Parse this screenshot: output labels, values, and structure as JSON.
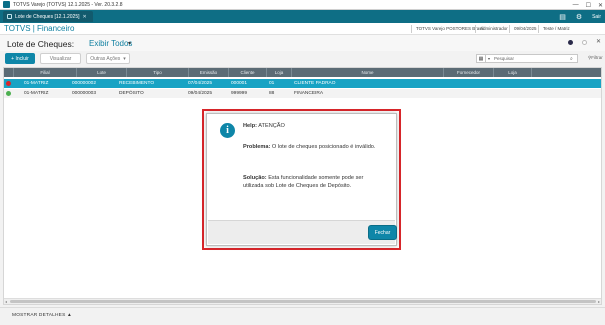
{
  "window": {
    "title": "TOTVS Varejo (TOTVS) 12.1.2025 - Ver. 20.3.2.8",
    "controls": [
      "—",
      "☐",
      "✕"
    ]
  },
  "tabbar": {
    "tab_label": "Lote de Cheques [12.1.2025]",
    "tab_close": "✕",
    "sair_label": "Sair"
  },
  "module": {
    "title": "TOTVS | Financeiro",
    "info": [
      "TOTVS Varejo POSTORES Brasil",
      "Administrador",
      "09/04/2025",
      "Teste / Matriz"
    ]
  },
  "page": {
    "title": "Lote de Cheques:",
    "view_label": "Exibir Todos",
    "view_caret": "▾"
  },
  "toolbar": {
    "include_label": "+ Incluir",
    "view_label": "Visualizar",
    "other_actions_label": "Outras Ações",
    "other_actions_caret": "▾",
    "search_placeholder": "Pesquisar",
    "filter_label": "Filtrar"
  },
  "grid": {
    "columns": [
      "",
      "Filial",
      "Lote",
      "Tipo",
      "Emissão",
      "Cliente",
      "Loja",
      "Nome",
      "Fornecedor",
      "Loja",
      ""
    ],
    "rows": [
      {
        "status": "red",
        "filial": "01-MATRIZ",
        "lote": "000000002",
        "tipo": "RECEBIMENTO",
        "emissao": "07/04/2025",
        "cliente": "000001",
        "loja": "01",
        "nome": "CLIENTE PADRAO",
        "fornecedor": "",
        "loja2": ""
      },
      {
        "status": "green",
        "filial": "01-MATRIZ",
        "lote": "000000003",
        "tipo": "DEPÓSITO",
        "emissao": "09/04/2025",
        "cliente": "999999",
        "loja": "88",
        "nome": "FINANCEIRA",
        "fornecedor": "",
        "loja2": ""
      }
    ]
  },
  "footer": {
    "more_details": "MOSTRAR DETALHES ▲"
  },
  "dialog": {
    "help_key": "Help:",
    "help_value": "ATENÇÃO",
    "problem_key": "Problema:",
    "problem_value": "O lote de cheques posicionado é inválido.",
    "solution_key": "Solução:",
    "solution_line1": "Esta funcionalidade somente pode ser",
    "solution_line2": "utilizada sob Lote de Cheques de Depósito.",
    "close_label": "Fechar"
  },
  "colors": {
    "accent": "#0e86a8",
    "tabbar": "#0e6e85",
    "selected_row": "#18a3c4",
    "highlight_frame": "#d9262b",
    "status_red": "#d9262b",
    "status_green": "#4caf50"
  }
}
